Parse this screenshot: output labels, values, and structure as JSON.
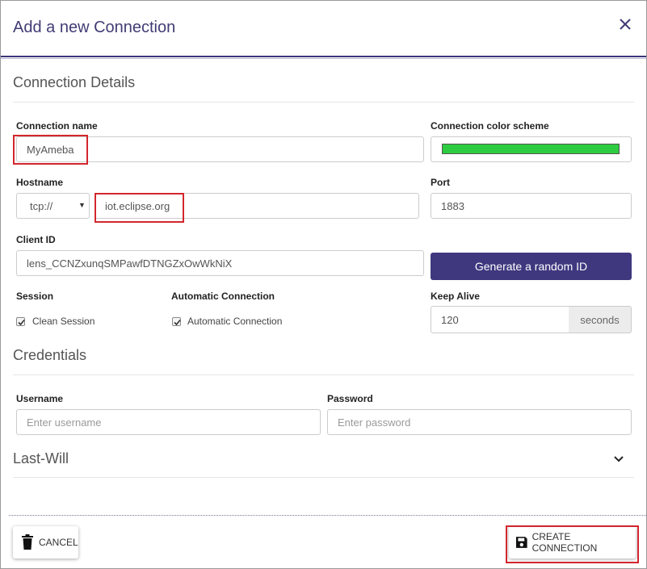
{
  "dialog": {
    "title": "Add a new Connection",
    "close_icon": "close-icon"
  },
  "connection_details": {
    "section_title": "Connection Details",
    "name_label": "Connection name",
    "name_value": "MyAmeba",
    "color_label": "Connection color scheme",
    "color_value": "#2ecc40",
    "hostname_label": "Hostname",
    "protocol_value": "tcp://",
    "hostname_value": "iot.eclipse.org",
    "port_label": "Port",
    "port_value": "1883",
    "client_id_label": "Client ID",
    "client_id_value": "lens_CCNZxunqSMPawfDTNGZxOwWkNiX",
    "generate_button": "Generate a random ID",
    "session_label": "Session",
    "clean_session_label": "Clean Session",
    "clean_session_checked": true,
    "auto_conn_label": "Automatic Connection",
    "auto_conn_checkbox_label": "Automatic Connection",
    "auto_conn_checked": true,
    "keep_alive_label": "Keep Alive",
    "keep_alive_value": "120",
    "keep_alive_unit": "seconds"
  },
  "credentials": {
    "section_title": "Credentials",
    "username_label": "Username",
    "username_placeholder": "Enter username",
    "password_label": "Password",
    "password_placeholder": "Enter password"
  },
  "last_will": {
    "section_title": "Last-Will",
    "expand_icon": "chevron-down-icon"
  },
  "footer": {
    "cancel_label": "CANCEL",
    "cancel_icon": "trash-icon",
    "create_label": "CREATE CONNECTION",
    "create_icon": "save-icon"
  },
  "colors": {
    "accent": "#3f387f",
    "highlight": "#d3262d"
  }
}
